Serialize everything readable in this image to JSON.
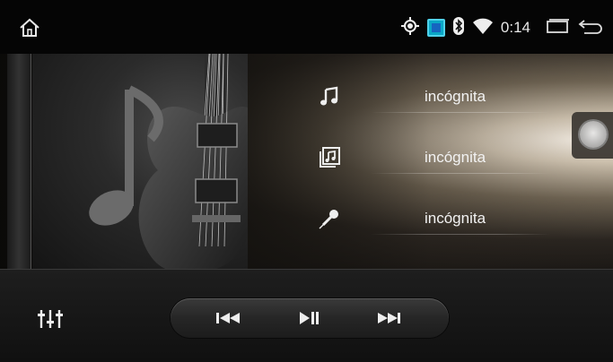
{
  "status_bar": {
    "time": "0:14",
    "icons": [
      "home-icon",
      "gps-icon",
      "navigation-app-icon",
      "bluetooth-icon",
      "wifi-icon",
      "recent-apps-icon",
      "back-icon"
    ]
  },
  "track_info": {
    "title": "incógnita",
    "album": "incógnita",
    "artist": "incógnita"
  },
  "controls": {
    "icons": [
      "equalizer-icon",
      "previous-icon",
      "play-pause-icon",
      "next-icon"
    ]
  },
  "colors": {
    "accent_cyan": "#0aa7c6",
    "text": "#f2f2f2"
  }
}
